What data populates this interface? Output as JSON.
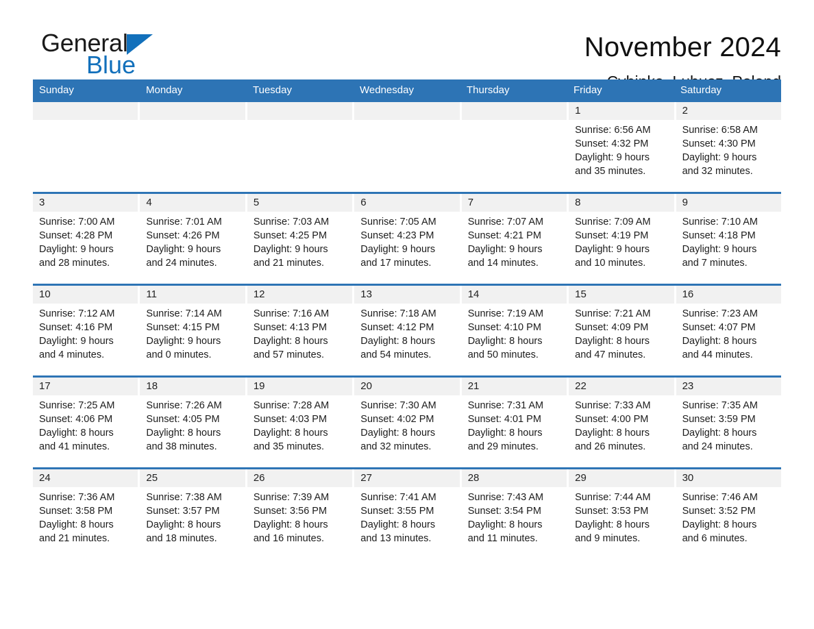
{
  "brand": {
    "name_part1": "General",
    "name_part2": "Blue",
    "triangle_color": "#1270bb"
  },
  "header": {
    "title": "November 2024",
    "subtitle": "Cybinka, Lubusz, Poland"
  },
  "theme": {
    "header_blue": "#2d74b5",
    "day_band_gray": "#f1f1f1",
    "text_color": "#1c1c1c"
  },
  "weekdays": [
    "Sunday",
    "Monday",
    "Tuesday",
    "Wednesday",
    "Thursday",
    "Friday",
    "Saturday"
  ],
  "weeks": [
    [
      {
        "day": "",
        "lines": []
      },
      {
        "day": "",
        "lines": []
      },
      {
        "day": "",
        "lines": []
      },
      {
        "day": "",
        "lines": []
      },
      {
        "day": "",
        "lines": []
      },
      {
        "day": "1",
        "lines": [
          "Sunrise: 6:56 AM",
          "Sunset: 4:32 PM",
          "Daylight: 9 hours",
          "and 35 minutes."
        ]
      },
      {
        "day": "2",
        "lines": [
          "Sunrise: 6:58 AM",
          "Sunset: 4:30 PM",
          "Daylight: 9 hours",
          "and 32 minutes."
        ]
      }
    ],
    [
      {
        "day": "3",
        "lines": [
          "Sunrise: 7:00 AM",
          "Sunset: 4:28 PM",
          "Daylight: 9 hours",
          "and 28 minutes."
        ]
      },
      {
        "day": "4",
        "lines": [
          "Sunrise: 7:01 AM",
          "Sunset: 4:26 PM",
          "Daylight: 9 hours",
          "and 24 minutes."
        ]
      },
      {
        "day": "5",
        "lines": [
          "Sunrise: 7:03 AM",
          "Sunset: 4:25 PM",
          "Daylight: 9 hours",
          "and 21 minutes."
        ]
      },
      {
        "day": "6",
        "lines": [
          "Sunrise: 7:05 AM",
          "Sunset: 4:23 PM",
          "Daylight: 9 hours",
          "and 17 minutes."
        ]
      },
      {
        "day": "7",
        "lines": [
          "Sunrise: 7:07 AM",
          "Sunset: 4:21 PM",
          "Daylight: 9 hours",
          "and 14 minutes."
        ]
      },
      {
        "day": "8",
        "lines": [
          "Sunrise: 7:09 AM",
          "Sunset: 4:19 PM",
          "Daylight: 9 hours",
          "and 10 minutes."
        ]
      },
      {
        "day": "9",
        "lines": [
          "Sunrise: 7:10 AM",
          "Sunset: 4:18 PM",
          "Daylight: 9 hours",
          "and 7 minutes."
        ]
      }
    ],
    [
      {
        "day": "10",
        "lines": [
          "Sunrise: 7:12 AM",
          "Sunset: 4:16 PM",
          "Daylight: 9 hours",
          "and 4 minutes."
        ]
      },
      {
        "day": "11",
        "lines": [
          "Sunrise: 7:14 AM",
          "Sunset: 4:15 PM",
          "Daylight: 9 hours",
          "and 0 minutes."
        ]
      },
      {
        "day": "12",
        "lines": [
          "Sunrise: 7:16 AM",
          "Sunset: 4:13 PM",
          "Daylight: 8 hours",
          "and 57 minutes."
        ]
      },
      {
        "day": "13",
        "lines": [
          "Sunrise: 7:18 AM",
          "Sunset: 4:12 PM",
          "Daylight: 8 hours",
          "and 54 minutes."
        ]
      },
      {
        "day": "14",
        "lines": [
          "Sunrise: 7:19 AM",
          "Sunset: 4:10 PM",
          "Daylight: 8 hours",
          "and 50 minutes."
        ]
      },
      {
        "day": "15",
        "lines": [
          "Sunrise: 7:21 AM",
          "Sunset: 4:09 PM",
          "Daylight: 8 hours",
          "and 47 minutes."
        ]
      },
      {
        "day": "16",
        "lines": [
          "Sunrise: 7:23 AM",
          "Sunset: 4:07 PM",
          "Daylight: 8 hours",
          "and 44 minutes."
        ]
      }
    ],
    [
      {
        "day": "17",
        "lines": [
          "Sunrise: 7:25 AM",
          "Sunset: 4:06 PM",
          "Daylight: 8 hours",
          "and 41 minutes."
        ]
      },
      {
        "day": "18",
        "lines": [
          "Sunrise: 7:26 AM",
          "Sunset: 4:05 PM",
          "Daylight: 8 hours",
          "and 38 minutes."
        ]
      },
      {
        "day": "19",
        "lines": [
          "Sunrise: 7:28 AM",
          "Sunset: 4:03 PM",
          "Daylight: 8 hours",
          "and 35 minutes."
        ]
      },
      {
        "day": "20",
        "lines": [
          "Sunrise: 7:30 AM",
          "Sunset: 4:02 PM",
          "Daylight: 8 hours",
          "and 32 minutes."
        ]
      },
      {
        "day": "21",
        "lines": [
          "Sunrise: 7:31 AM",
          "Sunset: 4:01 PM",
          "Daylight: 8 hours",
          "and 29 minutes."
        ]
      },
      {
        "day": "22",
        "lines": [
          "Sunrise: 7:33 AM",
          "Sunset: 4:00 PM",
          "Daylight: 8 hours",
          "and 26 minutes."
        ]
      },
      {
        "day": "23",
        "lines": [
          "Sunrise: 7:35 AM",
          "Sunset: 3:59 PM",
          "Daylight: 8 hours",
          "and 24 minutes."
        ]
      }
    ],
    [
      {
        "day": "24",
        "lines": [
          "Sunrise: 7:36 AM",
          "Sunset: 3:58 PM",
          "Daylight: 8 hours",
          "and 21 minutes."
        ]
      },
      {
        "day": "25",
        "lines": [
          "Sunrise: 7:38 AM",
          "Sunset: 3:57 PM",
          "Daylight: 8 hours",
          "and 18 minutes."
        ]
      },
      {
        "day": "26",
        "lines": [
          "Sunrise: 7:39 AM",
          "Sunset: 3:56 PM",
          "Daylight: 8 hours",
          "and 16 minutes."
        ]
      },
      {
        "day": "27",
        "lines": [
          "Sunrise: 7:41 AM",
          "Sunset: 3:55 PM",
          "Daylight: 8 hours",
          "and 13 minutes."
        ]
      },
      {
        "day": "28",
        "lines": [
          "Sunrise: 7:43 AM",
          "Sunset: 3:54 PM",
          "Daylight: 8 hours",
          "and 11 minutes."
        ]
      },
      {
        "day": "29",
        "lines": [
          "Sunrise: 7:44 AM",
          "Sunset: 3:53 PM",
          "Daylight: 8 hours",
          "and 9 minutes."
        ]
      },
      {
        "day": "30",
        "lines": [
          "Sunrise: 7:46 AM",
          "Sunset: 3:52 PM",
          "Daylight: 8 hours",
          "and 6 minutes."
        ]
      }
    ]
  ]
}
